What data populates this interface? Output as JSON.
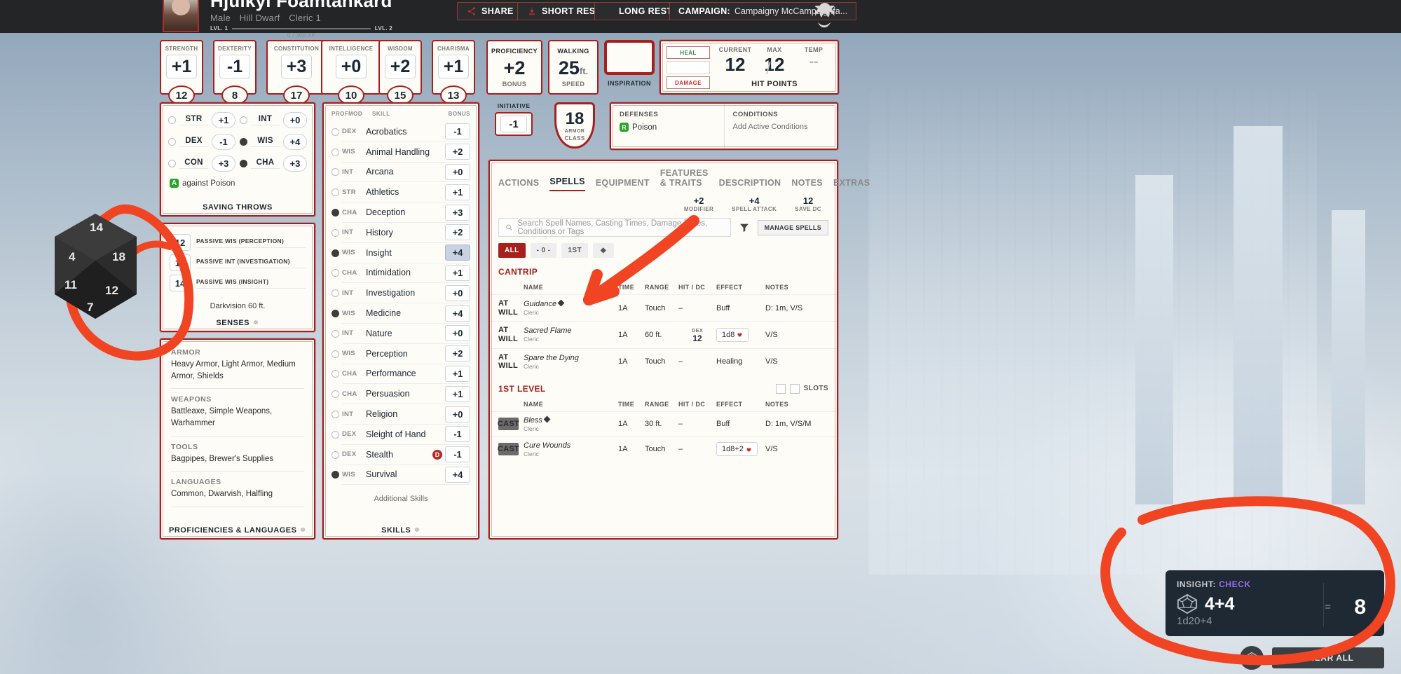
{
  "header": {
    "character_name": "Hjulkyl Foamtankard",
    "gender": "Male",
    "race": "Hill Dwarf",
    "class_level": "Cleric 1",
    "level_from": "LVL. 1",
    "level_to": "LVL. 2",
    "xp": "0 / 300 XP",
    "buttons": {
      "share": "SHARE",
      "short_rest": "SHORT REST",
      "long_rest": "LONG REST"
    },
    "campaign_label": "CAMPAIGN:",
    "campaign_value": "Campaigny McCampaignfa..."
  },
  "abilities": [
    {
      "name": "STRENGTH",
      "mod": "+1",
      "score": "12"
    },
    {
      "name": "DEXTERITY",
      "mod": "-1",
      "score": "8"
    },
    {
      "name": "CONSTITUTION",
      "mod": "+3",
      "score": "17"
    },
    {
      "name": "INTELLIGENCE",
      "mod": "+0",
      "score": "10"
    },
    {
      "name": "WISDOM",
      "mod": "+2",
      "score": "15"
    },
    {
      "name": "CHARISMA",
      "mod": "+1",
      "score": "13"
    }
  ],
  "proficiency": {
    "name": "PROFICIENCY",
    "value": "+2",
    "sub": "BONUS"
  },
  "speed": {
    "name": "WALKING",
    "value": "25",
    "unit": "ft.",
    "sub": "SPEED"
  },
  "inspiration": {
    "label": "INSPIRATION"
  },
  "hit_points": {
    "heal": "HEAL",
    "damage": "DAMAGE",
    "current_label": "CURRENT",
    "max_label": "MAX",
    "temp_label": "TEMP",
    "current": "12",
    "max": "12",
    "temp": "--",
    "footer": "HIT POINTS"
  },
  "saving_throws": {
    "rows": [
      {
        "name": "STR",
        "value": "+1",
        "prof": false
      },
      {
        "name": "INT",
        "value": "+0",
        "prof": false
      },
      {
        "name": "DEX",
        "value": "-1",
        "prof": false
      },
      {
        "name": "WIS",
        "value": "+4",
        "prof": true
      },
      {
        "name": "CON",
        "value": "+3",
        "prof": false
      },
      {
        "name": "CHA",
        "value": "+3",
        "prof": true
      }
    ],
    "note": "against Poison",
    "note_badge": "A",
    "footer": "SAVING THROWS"
  },
  "senses": {
    "rows": [
      {
        "value": "12",
        "label": "PASSIVE WIS (PERCEPTION)"
      },
      {
        "value": "10",
        "label": "PASSIVE INT (INVESTIGATION)"
      },
      {
        "value": "14",
        "label": "PASSIVE WIS (INSIGHT)"
      }
    ],
    "extra": "Darkvision 60 ft.",
    "footer": "SENSES"
  },
  "proficiencies": {
    "sections": [
      {
        "heading": "ARMOR",
        "value": "Heavy Armor, Light Armor, Medium Armor, Shields"
      },
      {
        "heading": "WEAPONS",
        "value": "Battleaxe, Simple Weapons, Warhammer"
      },
      {
        "heading": "TOOLS",
        "value": "Bagpipes, Brewer's Supplies"
      },
      {
        "heading": "LANGUAGES",
        "value": "Common, Dwarvish, Halfling"
      }
    ],
    "footer": "PROFICIENCIES & LANGUAGES"
  },
  "skills": {
    "headers": {
      "prof": "PROF",
      "mod": "MOD",
      "skill": "SKILL",
      "bonus": "BONUS"
    },
    "rows": [
      {
        "mod": "DEX",
        "name": "Acrobatics",
        "bonus": "-1",
        "prof": false
      },
      {
        "mod": "WIS",
        "name": "Animal Handling",
        "bonus": "+2",
        "prof": false
      },
      {
        "mod": "INT",
        "name": "Arcana",
        "bonus": "+0",
        "prof": false
      },
      {
        "mod": "STR",
        "name": "Athletics",
        "bonus": "+1",
        "prof": false
      },
      {
        "mod": "CHA",
        "name": "Deception",
        "bonus": "+3",
        "prof": true
      },
      {
        "mod": "INT",
        "name": "History",
        "bonus": "+2",
        "prof": false
      },
      {
        "mod": "WIS",
        "name": "Insight",
        "bonus": "+4",
        "prof": true,
        "highlight": true
      },
      {
        "mod": "CHA",
        "name": "Intimidation",
        "bonus": "+1",
        "prof": false
      },
      {
        "mod": "INT",
        "name": "Investigation",
        "bonus": "+0",
        "prof": false
      },
      {
        "mod": "WIS",
        "name": "Medicine",
        "bonus": "+4",
        "prof": true
      },
      {
        "mod": "INT",
        "name": "Nature",
        "bonus": "+0",
        "prof": false
      },
      {
        "mod": "WIS",
        "name": "Perception",
        "bonus": "+2",
        "prof": false
      },
      {
        "mod": "CHA",
        "name": "Performance",
        "bonus": "+1",
        "prof": false
      },
      {
        "mod": "CHA",
        "name": "Persuasion",
        "bonus": "+1",
        "prof": false
      },
      {
        "mod": "INT",
        "name": "Religion",
        "bonus": "+0",
        "prof": false
      },
      {
        "mod": "DEX",
        "name": "Sleight of Hand",
        "bonus": "-1",
        "prof": false
      },
      {
        "mod": "DEX",
        "name": "Stealth",
        "bonus": "-1",
        "prof": false,
        "badge": "D"
      },
      {
        "mod": "WIS",
        "name": "Survival",
        "bonus": "+4",
        "prof": true
      }
    ],
    "extra": "Additional Skills",
    "footer": "SKILLS"
  },
  "initiative": {
    "label": "INITIATIVE",
    "value": "-1"
  },
  "armor_class": {
    "value": "18",
    "label": "CLASS",
    "top": "ARMOR"
  },
  "defenses": {
    "heading": "DEFENSES",
    "items": [
      {
        "badge": "R",
        "name": "Poison"
      }
    ],
    "conditions_heading": "CONDITIONS",
    "conditions_add": "Add Active Conditions"
  },
  "tabs": [
    {
      "label": "ACTIONS",
      "active": false
    },
    {
      "label": "SPELLS",
      "active": true
    },
    {
      "label": "EQUIPMENT",
      "active": false
    },
    {
      "label": "FEATURES & TRAITS",
      "active": false
    },
    {
      "label": "DESCRIPTION",
      "active": false
    },
    {
      "label": "NOTES",
      "active": false
    },
    {
      "label": "EXTRAS",
      "active": false
    }
  ],
  "spell_meta": [
    {
      "value": "+2",
      "label": "MODIFIER"
    },
    {
      "value": "+4",
      "label": "SPELL ATTACK"
    },
    {
      "value": "12",
      "label": "SAVE DC"
    }
  ],
  "spell_search": {
    "placeholder": "Search Spell Names, Casting Times, Damage Types, Conditions or Tags",
    "manage_label": "MANAGE SPELLS"
  },
  "level_chips": [
    {
      "label": "ALL",
      "active": true
    },
    {
      "label": "- 0 -",
      "active": false
    },
    {
      "label": "1ST",
      "active": false
    },
    {
      "label": "◆",
      "active": false
    }
  ],
  "spell_table": {
    "headers": {
      "name": "NAME",
      "time": "TIME",
      "range": "RANGE",
      "hit_dc": "HIT / DC",
      "effect": "EFFECT",
      "notes": "NOTES"
    },
    "sections": [
      {
        "title": "CANTRIP",
        "slots_label": null,
        "rows": [
          {
            "action": "AT WILL",
            "name": "Guidance",
            "concentration": true,
            "source": "Cleric",
            "time": "1A",
            "range": "Touch",
            "hit_dc": "–",
            "effect": "Buff",
            "notes": "D: 1m, V/S"
          },
          {
            "action": "AT WILL",
            "name": "Sacred Flame",
            "concentration": false,
            "source": "Cleric",
            "time": "1A",
            "range": "60 ft.",
            "hit_dc_type": "DEX",
            "hit_dc": "12",
            "effect": "1d8",
            "notes": "V/S"
          },
          {
            "action": "AT WILL",
            "name": "Spare the Dying",
            "concentration": false,
            "source": "Cleric",
            "time": "1A",
            "range": "Touch",
            "hit_dc": "–",
            "effect": "Healing",
            "notes": "V/S"
          }
        ]
      },
      {
        "title": "1ST LEVEL",
        "slots_label": "SLOTS",
        "rows": [
          {
            "action": "CAST",
            "name": "Bless",
            "concentration": true,
            "source": "Cleric",
            "time": "1A",
            "range": "30 ft.",
            "hit_dc": "–",
            "effect": "Buff",
            "notes": "D: 1m, V/S/M"
          },
          {
            "action": "CAST",
            "name": "Cure Wounds",
            "concentration": false,
            "source": "Cleric",
            "time": "1A",
            "range": "Touch",
            "hit_dc": "–",
            "effect": "1d8+2",
            "notes": "V/S"
          }
        ]
      }
    ]
  },
  "dice_tray": {
    "title_prefix": "INSIGHT:",
    "title_type": "CHECK",
    "expression": "4+4",
    "formula": "1d20+4",
    "equals": "=",
    "total": "8",
    "clear_label": "CLEAR ALL"
  },
  "colors": {
    "accent_red": "#a8201e",
    "dark_bar": "#242527",
    "paper": "#fdfcf7",
    "annotation": "#f04423",
    "check_purple": "#9b6bf0"
  }
}
